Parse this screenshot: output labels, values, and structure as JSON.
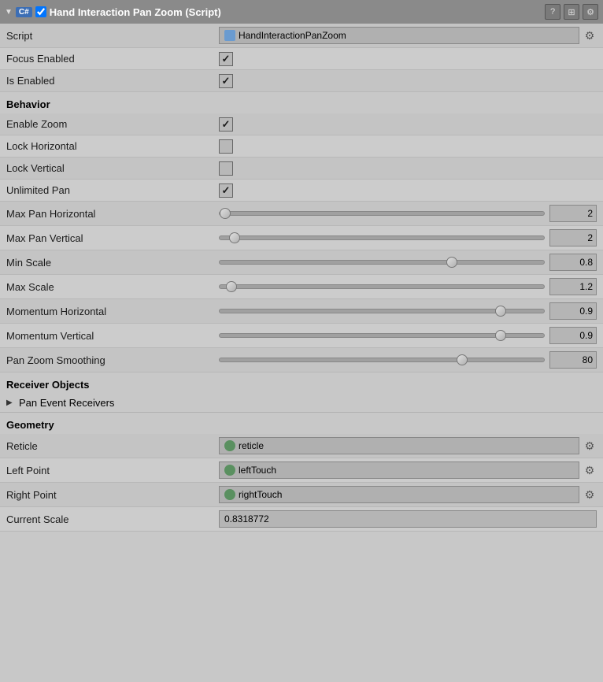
{
  "header": {
    "badge": "C#",
    "title": "Hand Interaction Pan Zoom (Script)",
    "icons": [
      "?",
      "⊞",
      "⚙"
    ]
  },
  "script_row": {
    "label": "Script",
    "value": "HandInteractionPanZoom",
    "gear": "⚙"
  },
  "fields": {
    "focus_enabled": {
      "label": "Focus Enabled",
      "checked": true
    },
    "is_enabled": {
      "label": "Is Enabled",
      "checked": true
    }
  },
  "behavior": {
    "section_label": "Behavior",
    "enable_zoom": {
      "label": "Enable Zoom",
      "checked": true
    },
    "lock_horizontal": {
      "label": "Lock Horizontal",
      "checked": false
    },
    "lock_vertical": {
      "label": "Lock Vertical",
      "checked": false
    },
    "unlimited_pan": {
      "label": "Unlimited Pan",
      "checked": true
    },
    "max_pan_horizontal": {
      "label": "Max Pan Horizontal",
      "value": "2",
      "thumb_pct": 0
    },
    "max_pan_vertical": {
      "label": "Max Pan Vertical",
      "value": "2",
      "thumb_pct": 3
    },
    "min_scale": {
      "label": "Min Scale",
      "value": "0.8",
      "thumb_pct": 70
    },
    "max_scale": {
      "label": "Max Scale",
      "value": "1.2",
      "thumb_pct": 2
    },
    "momentum_horizontal": {
      "label": "Momentum Horizontal",
      "value": "0.9",
      "thumb_pct": 85
    },
    "momentum_vertical": {
      "label": "Momentum Vertical",
      "value": "0.9",
      "thumb_pct": 85
    },
    "pan_zoom_smoothing": {
      "label": "Pan Zoom Smoothing",
      "value": "80",
      "thumb_pct": 73
    }
  },
  "receiver_objects": {
    "section_label": "Receiver Objects",
    "pan_event_receivers": {
      "label": "Pan Event Receivers"
    }
  },
  "geometry": {
    "section_label": "Geometry",
    "reticle": {
      "label": "Reticle",
      "value": "reticle"
    },
    "left_point": {
      "label": "Left Point",
      "value": "leftTouch"
    },
    "right_point": {
      "label": "Right Point",
      "value": "rightTouch"
    },
    "current_scale": {
      "label": "Current Scale",
      "value": "0.8318772"
    }
  }
}
